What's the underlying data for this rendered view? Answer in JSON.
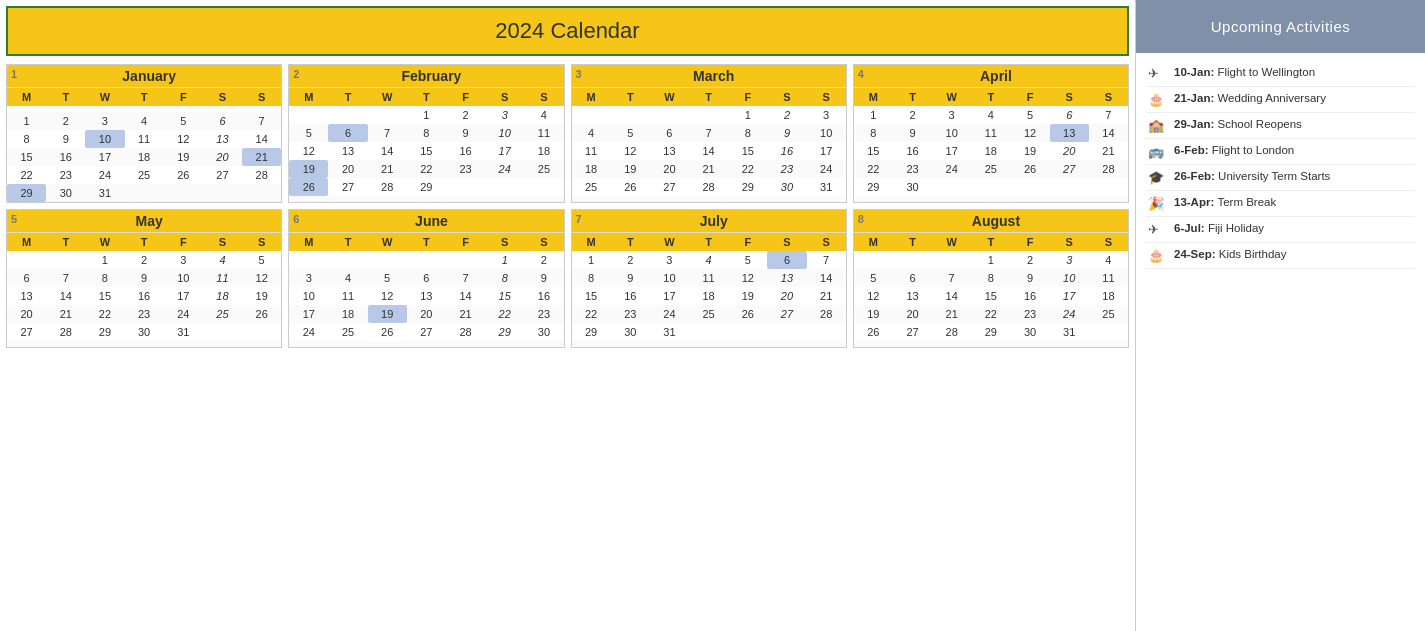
{
  "title": "2024 Calendar",
  "sidebar": {
    "heading": "Upcoming Activities",
    "activities": [
      {
        "icon": "✈",
        "date": "10-Jan:",
        "desc": "Flight to Wellington"
      },
      {
        "icon": "🎂",
        "date": "21-Jan:",
        "desc": "Wedding Anniversary"
      },
      {
        "icon": "🏫",
        "date": "29-Jan:",
        "desc": "School Reopens"
      },
      {
        "icon": "🚌",
        "date": "6-Feb:",
        "desc": "Flight to London"
      },
      {
        "icon": "🎓",
        "date": "26-Feb:",
        "desc": "University Term Starts"
      },
      {
        "icon": "🎉",
        "date": "13-Apr:",
        "desc": "Term Break"
      },
      {
        "icon": "✈",
        "date": "6-Jul:",
        "desc": "Fiji Holiday"
      },
      {
        "icon": "🎂",
        "date": "24-Sep:",
        "desc": "Kids Birthday"
      }
    ]
  },
  "months": [
    {
      "num": 1,
      "name": "January",
      "days": [
        [
          "",
          "",
          "",
          "",
          "",
          "",
          ""
        ],
        [
          "1",
          "2",
          "3",
          "4",
          "5",
          "6i",
          "7"
        ],
        [
          "8",
          "9",
          "10b",
          "11",
          "12",
          "13i",
          "14"
        ],
        [
          "15",
          "16",
          "17",
          "18",
          "19",
          "20i",
          "21b"
        ],
        [
          "22",
          "23",
          "24",
          "25",
          "26",
          "27",
          "28"
        ],
        [
          "29b",
          "30",
          "31",
          "",
          "",
          "",
          ""
        ]
      ]
    },
    {
      "num": 2,
      "name": "February",
      "days": [
        [
          "",
          "",
          "",
          "1",
          "2",
          "3i",
          "4"
        ],
        [
          "5",
          "6b",
          "7",
          "8",
          "9",
          "10i",
          "11"
        ],
        [
          "12",
          "13",
          "14",
          "15",
          "16",
          "17i",
          "18"
        ],
        [
          "19b",
          "20",
          "21",
          "22",
          "23",
          "24i",
          "25"
        ],
        [
          "26b",
          "27",
          "28",
          "29",
          "",
          "",
          ""
        ],
        [
          "",
          "",
          "",
          "",
          "",
          "",
          ""
        ]
      ]
    },
    {
      "num": 3,
      "name": "March",
      "days": [
        [
          "",
          "",
          "",
          "",
          "1",
          "2i",
          "3"
        ],
        [
          "4",
          "5",
          "6",
          "7",
          "8",
          "9i",
          "10"
        ],
        [
          "11",
          "12",
          "13",
          "14",
          "15",
          "16i",
          "17"
        ],
        [
          "18",
          "19",
          "20",
          "21",
          "22",
          "23i",
          "24"
        ],
        [
          "25",
          "26",
          "27",
          "28",
          "29",
          "30i",
          "31"
        ],
        [
          "",
          "",
          "",
          "",
          "",
          "",
          ""
        ]
      ]
    },
    {
      "num": 4,
      "name": "April",
      "days": [
        [
          "1",
          "2",
          "3",
          "4",
          "5",
          "6i",
          "7"
        ],
        [
          "8",
          "9",
          "10",
          "11",
          "12",
          "13b",
          "14"
        ],
        [
          "15",
          "16",
          "17",
          "18",
          "19",
          "20i",
          "21"
        ],
        [
          "22",
          "23",
          "24",
          "25",
          "26",
          "27i",
          "28"
        ],
        [
          "29",
          "30",
          "",
          "",
          "",
          "",
          ""
        ],
        [
          "",
          "",
          "",
          "",
          "",
          "",
          ""
        ]
      ]
    },
    {
      "num": 5,
      "name": "May",
      "days": [
        [
          "",
          "",
          "1",
          "2",
          "3",
          "4i",
          "5"
        ],
        [
          "6",
          "7",
          "8",
          "9",
          "10",
          "11i",
          "12"
        ],
        [
          "13",
          "14",
          "15",
          "16",
          "17",
          "18i",
          "19"
        ],
        [
          "20",
          "21",
          "22",
          "23",
          "24",
          "25i",
          "26"
        ],
        [
          "27",
          "28",
          "29",
          "30",
          "31",
          "",
          ""
        ],
        [
          "",
          "",
          "",
          "",
          "",
          "",
          ""
        ]
      ]
    },
    {
      "num": 6,
      "name": "June",
      "days": [
        [
          "",
          "",
          "",
          "",
          "",
          "1i",
          "2"
        ],
        [
          "3",
          "4",
          "5",
          "6",
          "7",
          "8i",
          "9"
        ],
        [
          "10",
          "11",
          "12",
          "13",
          "14",
          "15i",
          "16"
        ],
        [
          "17",
          "18",
          "19b",
          "20",
          "21",
          "22i",
          "23"
        ],
        [
          "24",
          "25",
          "26",
          "27",
          "28",
          "29i",
          "30"
        ],
        [
          "",
          "",
          "",
          "",
          "",
          "",
          ""
        ]
      ]
    },
    {
      "num": 7,
      "name": "July",
      "days": [
        [
          "1",
          "2",
          "3",
          "4i",
          "5",
          "6b",
          "7"
        ],
        [
          "8",
          "9",
          "10",
          "11",
          "12",
          "13i",
          "14"
        ],
        [
          "15",
          "16",
          "17",
          "18",
          "19",
          "20i",
          "21"
        ],
        [
          "22",
          "23",
          "24",
          "25",
          "26",
          "27i",
          "28"
        ],
        [
          "29",
          "30",
          "31",
          "",
          "",
          "",
          ""
        ],
        [
          "",
          "",
          "",
          "",
          "",
          "",
          ""
        ]
      ]
    },
    {
      "num": 8,
      "name": "August",
      "days": [
        [
          "",
          "",
          "",
          "1",
          "2",
          "3i",
          "4"
        ],
        [
          "5",
          "6",
          "7",
          "8",
          "9",
          "10i",
          "11"
        ],
        [
          "12",
          "13",
          "14",
          "15",
          "16",
          "17i",
          "18"
        ],
        [
          "19",
          "20",
          "21",
          "22",
          "23",
          "24i",
          "25"
        ],
        [
          "26",
          "27",
          "28",
          "29",
          "30",
          "31",
          ""
        ],
        [
          "",
          "",
          "",
          "",
          "",
          "",
          ""
        ]
      ]
    }
  ],
  "weekdays": [
    "M",
    "T",
    "W",
    "T",
    "F",
    "S",
    "S"
  ]
}
